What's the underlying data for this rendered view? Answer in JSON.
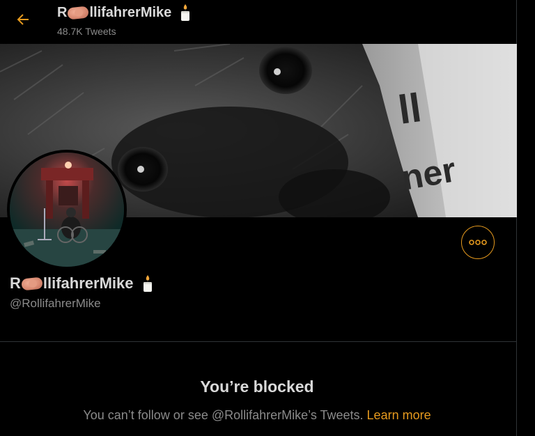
{
  "header": {
    "name_prefix": "R",
    "name_suffix": "llifahrerMike",
    "tweet_count": "48.7K Tweets"
  },
  "profile": {
    "name_prefix": "R",
    "name_suffix": "llifahrerMike",
    "handle": "@RollifahrerMike"
  },
  "blocked": {
    "title": "You’re blocked",
    "message": "You can’t follow or see @RollifahrerMike’s Tweets.",
    "learn_more": "Learn more"
  },
  "banner_lettering": [
    "ll",
    "ner"
  ],
  "icons": {
    "back": "arrow-left-icon",
    "more": "more-horizontal-icon",
    "name_emoji_1": "sausage-emoji",
    "name_emoji_2": "candle-emoji"
  },
  "colors": {
    "background": "#000000",
    "accent": "#e69a1e",
    "text_primary": "#d9d9d9",
    "text_secondary": "#8b8b8b",
    "divider": "#2f3336"
  }
}
